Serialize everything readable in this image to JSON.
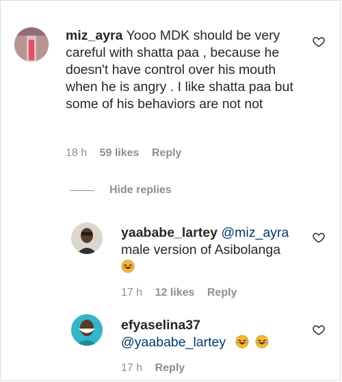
{
  "comments": [
    {
      "username": "miz_ayra",
      "text": "Yooo MDK should be very careful with shatta paa , because he doesn't have control over his mouth when he is angry . I like shatta paa but some of his behaviors are not not",
      "time": "18 h",
      "likes": "59 likes",
      "reply_label": "Reply"
    }
  ],
  "hide_replies_label": "Hide replies",
  "replies": [
    {
      "username": "yaababe_lartey",
      "mention": "@miz_ayra",
      "text": "male version of Asibolanga",
      "emoji_count": 1,
      "time": "17 h",
      "likes": "12 likes",
      "reply_label": "Reply"
    },
    {
      "username": "efyaselina37",
      "mention": "@yaababe_lartey",
      "text": "",
      "emoji_count": 2,
      "time": "17 h",
      "reply_label": "Reply"
    }
  ],
  "icons": {
    "like": "heart-outline-icon",
    "emoji": "laughing-face-emoji"
  },
  "colors": {
    "text": "#262626",
    "meta": "#8e8e8e",
    "mention": "#00376b",
    "border": "#dbdbdb"
  }
}
